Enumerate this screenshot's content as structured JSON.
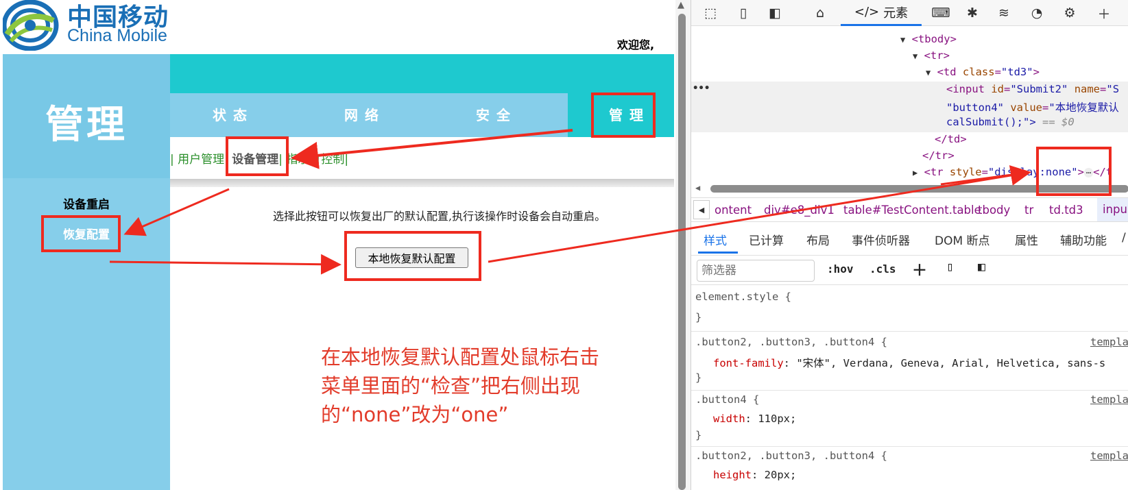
{
  "router": {
    "logo_cn": "中国移动",
    "logo_en": "China Mobile",
    "welcome": "欢迎您,",
    "banner_title": "管理",
    "tabs": [
      "状态",
      "网络",
      "安全"
    ],
    "tab_active": "管理",
    "subnav": {
      "sep1": "| ",
      "item1": "用户管理",
      "sep2": "| ",
      "item2": "设备管理",
      "sep3": "| ",
      "item3": "指示灯控制",
      "sep4": "|"
    },
    "side": {
      "title": "设备重启",
      "link": "恢复配置"
    },
    "description": "选择此按钮可以恢复出厂的默认配置,执行该操作时设备会自动重启。",
    "restore_button": "本地恢复默认配置",
    "note_lines": [
      "在本地恢复默认配置处鼠标右击",
      "菜单里面的“检查”把右侧出现",
      "的“none”改为“one”"
    ],
    "annotation_color": "#ee2a1f"
  },
  "devtools": {
    "elements_tab": "元素",
    "dom_lines": {
      "tbody": "<tbody>",
      "tr": "<tr>",
      "td_open_tag": "<td ",
      "td_attr": "class",
      "td_val": "\"td3\"",
      "td_close": ">",
      "input_tag": "<input ",
      "input_attr1": "id",
      "input_val1": "\"Submit2\"",
      "input_attr2": "name",
      "input_val2": "\"S",
      "line2_val": "\"button4\"",
      "line2_attr": "value",
      "line2_val2": "\"本地恢复默认",
      "line3_val": "calSubmit();\">",
      "line3_dim": " == $0",
      "td_end": "</td>",
      "tr_end": "</tr>",
      "tr2_open": "<tr ",
      "tr2_attr": "style",
      "tr2_val": "\"display:none\"",
      "tr2_close": ">",
      "tr2_end": "</t"
    },
    "breadcrumbs": [
      "ontent",
      "div#e8_div1",
      "table#TestContent.table",
      "tbody",
      "tr",
      "td.td3",
      "inpu"
    ],
    "style_tabs": [
      "样式",
      "已计算",
      "布局",
      "事件侦听器",
      "DOM 断点",
      "属性",
      "辅助功能",
      "/"
    ],
    "filter_placeholder": "筛选器",
    "filter_buttons": [
      ":hov",
      ".cls"
    ],
    "css_rules": {
      "element_style": "element.style {",
      "close": "}",
      "rule1_sel": ".button2, .button3, .button4 {",
      "rule1_prop": "font-family",
      "rule1_val": "\"宋体\", Verdana, Geneva, Arial, Helvetica, sans-s",
      "rule2_sel": ".button4 {",
      "rule2_prop": "width",
      "rule2_val": "110px;",
      "rule3_sel": ".button2, .button3, .button4 {",
      "rule3_prop": "height",
      "rule3_val": "20px;",
      "src": "templa"
    }
  }
}
